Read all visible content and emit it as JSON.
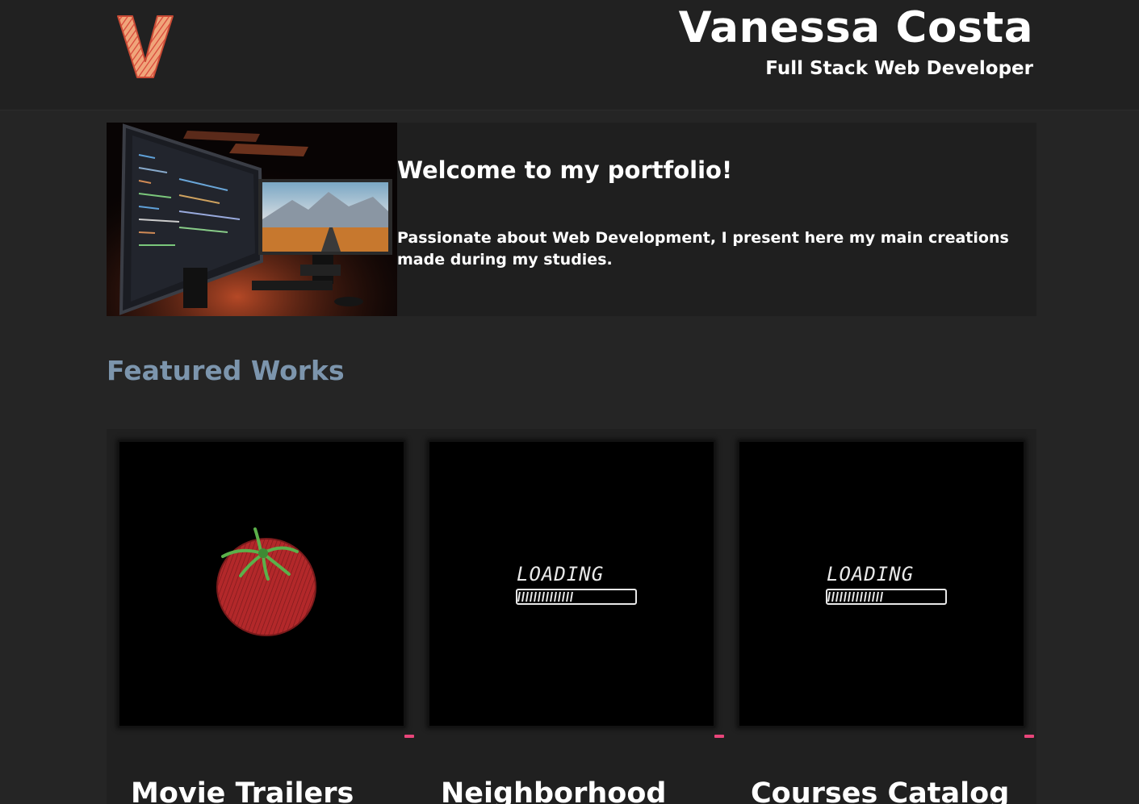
{
  "header": {
    "logo_letter": "V",
    "name": "Vanessa Costa",
    "role": "Full Stack Web Developer"
  },
  "intro": {
    "heading": "Welcome to my portfolio!",
    "text": "Passionate about Web Development, I present here my main creations made during my studies."
  },
  "featured": {
    "title": "Featured Works",
    "cards": [
      {
        "title": "Movie Trailers",
        "thumbnail": "tomato-illustration"
      },
      {
        "title": "Neighborhood",
        "thumbnail": "loading-illustration",
        "thumb_text": "LOADING"
      },
      {
        "title": "Courses Catalog",
        "thumbnail": "loading-illustration",
        "thumb_text": "LOADING"
      }
    ]
  },
  "colors": {
    "background": "#252525",
    "header_bg": "#212121",
    "section_title": "#7c95ad",
    "accent": "#e8457a",
    "logo": "#e8845a"
  }
}
